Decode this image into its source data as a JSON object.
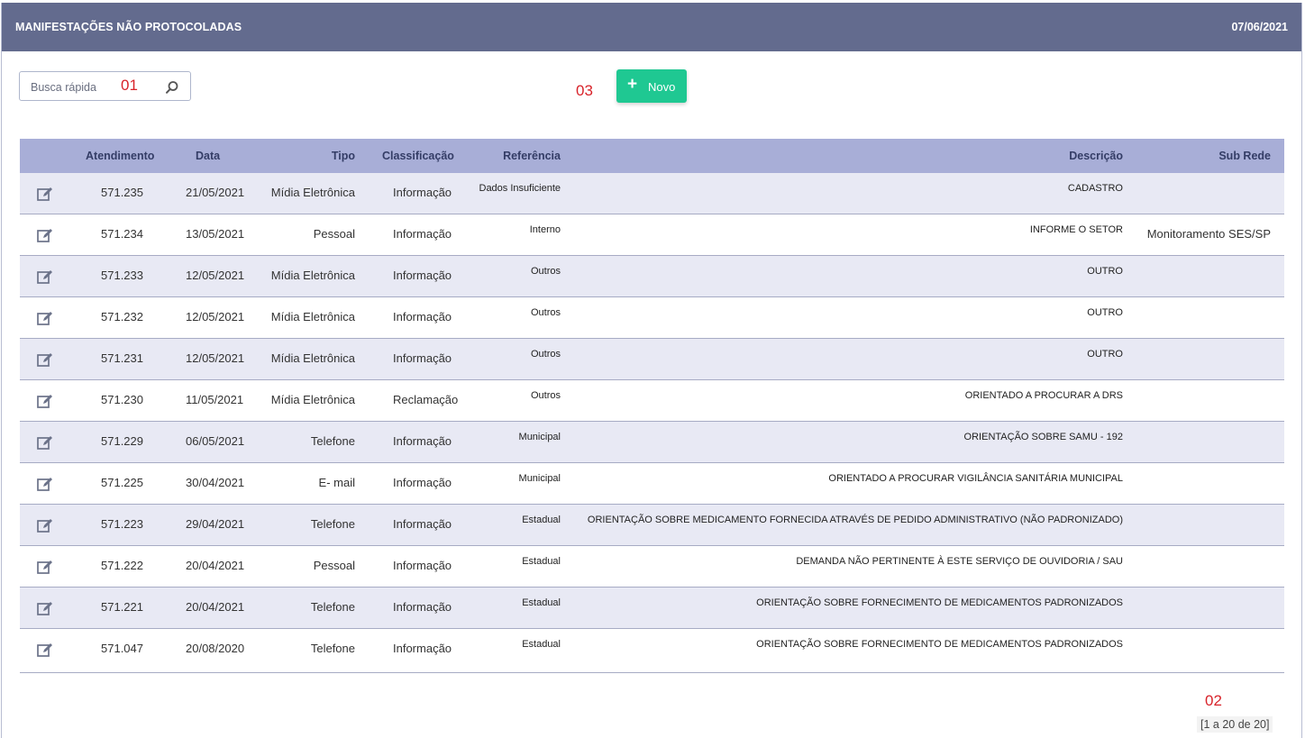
{
  "header": {
    "title": "MANIFESTAÇÕES NÃO PROTOCOLADAS",
    "date": "07/06/2021"
  },
  "search": {
    "placeholder": "Busca rápida",
    "icon": "search-icon"
  },
  "markers": {
    "m1": "01",
    "m2": "02",
    "m3": "03"
  },
  "new_button": {
    "label": "Novo",
    "icon": "plus-icon",
    "color": "#1fc892"
  },
  "table": {
    "columns": {
      "atendimento": "Atendimento",
      "data": "Data",
      "tipo": "Tipo",
      "classificacao": "Classificação",
      "referencia": "Referência",
      "descricao": "Descrição",
      "subrede": "Sub Rede"
    },
    "rows": [
      {
        "atendimento": "571.235",
        "data": "21/05/2021",
        "tipo": "Mídia Eletrônica",
        "classificacao": "Informação",
        "referencia": "Dados Insuficiente",
        "descricao": "CADASTRO",
        "subrede": ""
      },
      {
        "atendimento": "571.234",
        "data": "13/05/2021",
        "tipo": "Pessoal",
        "classificacao": "Informação",
        "referencia": "Interno",
        "descricao": "INFORME O SETOR",
        "subrede": "Monitoramento SES/SP"
      },
      {
        "atendimento": "571.233",
        "data": "12/05/2021",
        "tipo": "Mídia Eletrônica",
        "classificacao": "Informação",
        "referencia": "Outros",
        "descricao": "OUTRO",
        "subrede": ""
      },
      {
        "atendimento": "571.232",
        "data": "12/05/2021",
        "tipo": "Mídia Eletrônica",
        "classificacao": "Informação",
        "referencia": "Outros",
        "descricao": "OUTRO",
        "subrede": ""
      },
      {
        "atendimento": "571.231",
        "data": "12/05/2021",
        "tipo": "Mídia Eletrônica",
        "classificacao": "Informação",
        "referencia": "Outros",
        "descricao": "OUTRO",
        "subrede": ""
      },
      {
        "atendimento": "571.230",
        "data": "11/05/2021",
        "tipo": "Mídia Eletrônica",
        "classificacao": "Reclamação",
        "referencia": "Outros",
        "descricao": "ORIENTADO A PROCURAR A DRS",
        "subrede": ""
      },
      {
        "atendimento": "571.229",
        "data": "06/05/2021",
        "tipo": "Telefone",
        "classificacao": "Informação",
        "referencia": "Municipal",
        "descricao": "ORIENTAÇÃO SOBRE SAMU - 192",
        "subrede": ""
      },
      {
        "atendimento": "571.225",
        "data": "30/04/2021",
        "tipo": "E- mail",
        "classificacao": "Informação",
        "referencia": "Municipal",
        "descricao": "ORIENTADO A PROCURAR VIGILÂNCIA SANITÁRIA MUNICIPAL",
        "subrede": ""
      },
      {
        "atendimento": "571.223",
        "data": "29/04/2021",
        "tipo": "Telefone",
        "classificacao": "Informação",
        "referencia": "Estadual",
        "descricao": "ORIENTAÇÃO SOBRE MEDICAMENTO FORNECIDA ATRAVÉS DE PEDIDO ADMINISTRATIVO (NÃO PADRONIZADO)",
        "subrede": ""
      },
      {
        "atendimento": "571.222",
        "data": "20/04/2021",
        "tipo": "Pessoal",
        "classificacao": "Informação",
        "referencia": "Estadual",
        "descricao": "DEMANDA NÃO PERTINENTE À ESTE SERVIÇO DE OUVIDORIA / SAU",
        "subrede": ""
      },
      {
        "atendimento": "571.221",
        "data": "20/04/2021",
        "tipo": "Telefone",
        "classificacao": "Informação",
        "referencia": "Estadual",
        "descricao": "ORIENTAÇÃO SOBRE FORNECIMENTO DE MEDICAMENTOS PADRONIZADOS",
        "subrede": ""
      },
      {
        "atendimento": "571.047",
        "data": "20/08/2020",
        "tipo": "Telefone",
        "classificacao": "Informação",
        "referencia": "Estadual",
        "descricao": "ORIENTAÇÃO SOBRE FORNECIMENTO DE MEDICAMENTOS PADRONIZADOS",
        "subrede": ""
      }
    ]
  },
  "pagination": {
    "text": "[1 a 20 de 20]"
  },
  "colors": {
    "header_bg": "#636b8e",
    "table_header_bg": "#a8aed7",
    "row_alt_bg": "#e8e9f4",
    "marker": "#d8232a"
  }
}
